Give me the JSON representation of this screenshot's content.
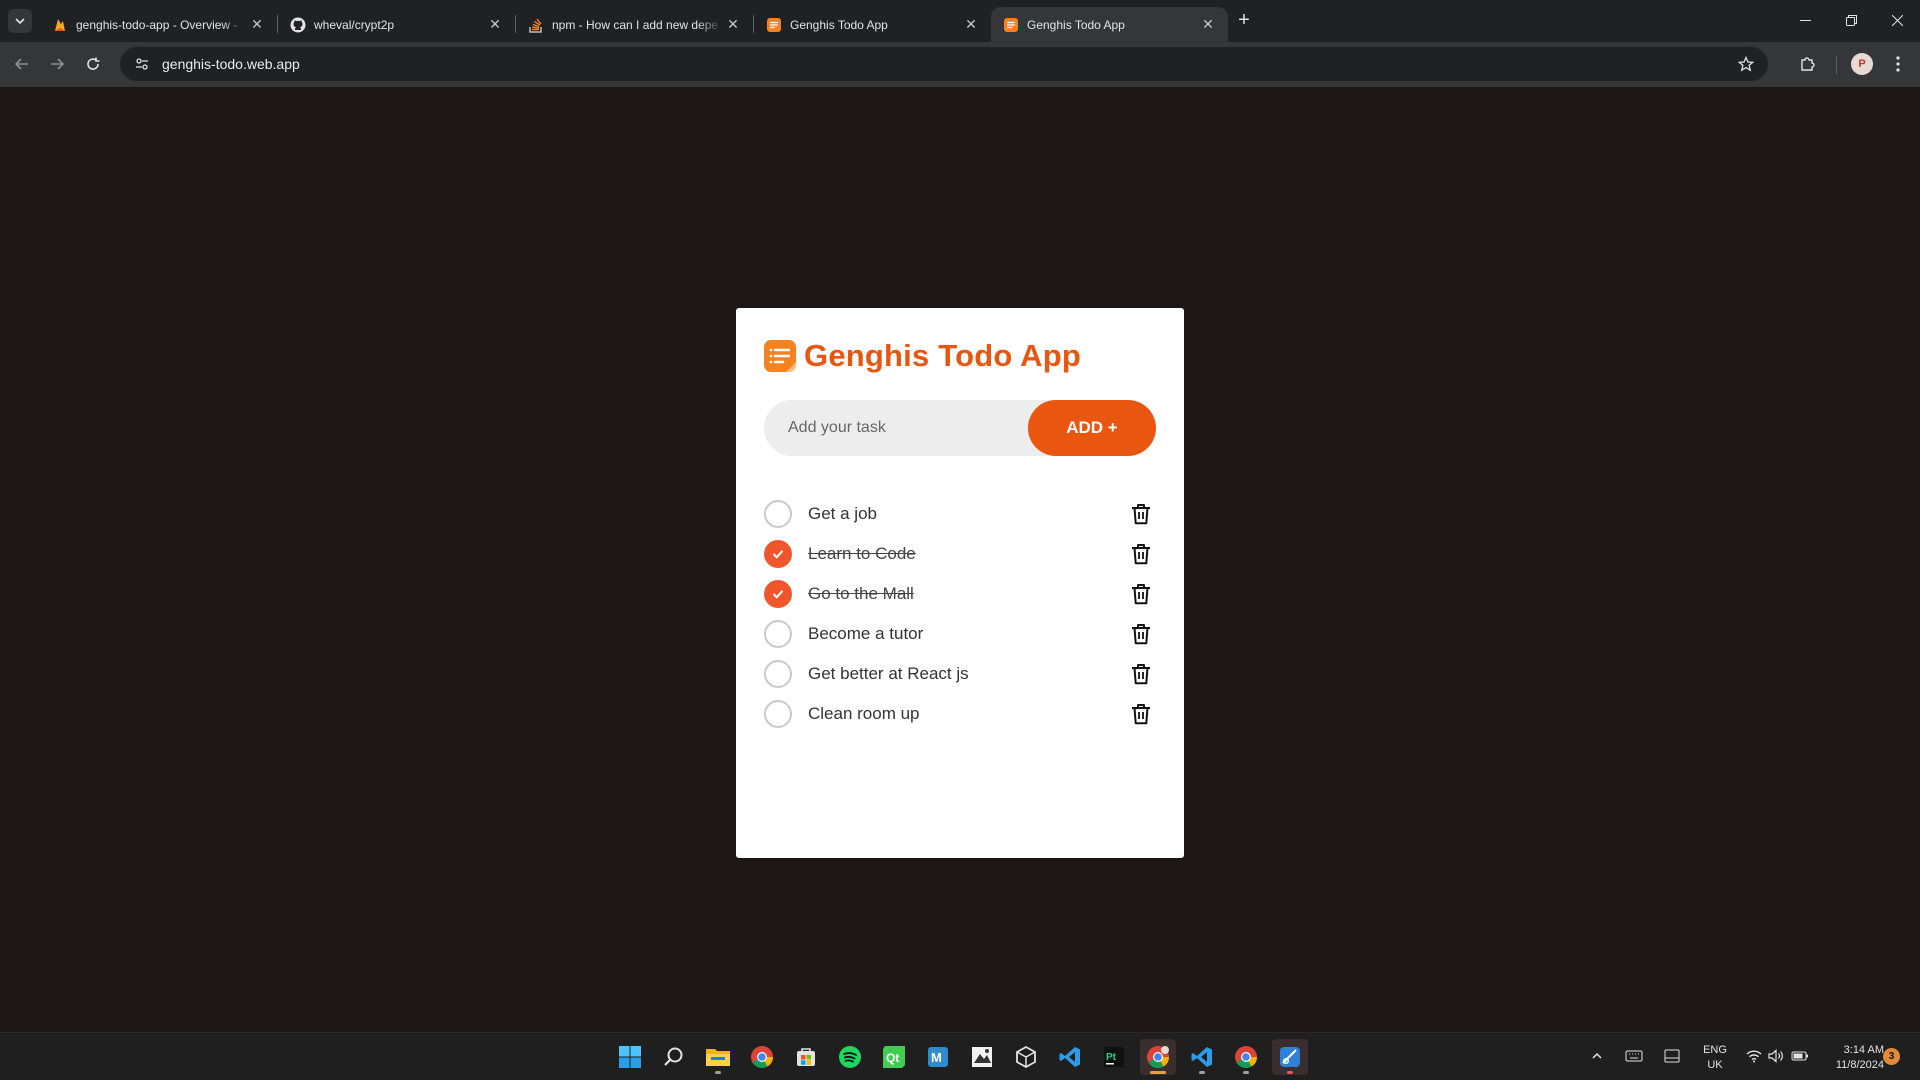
{
  "browser": {
    "tabs": [
      {
        "title": "genghis-todo-app - Overview -",
        "icon": "firebase-icon",
        "active": false
      },
      {
        "title": "wheval/crypt2p",
        "icon": "github-icon",
        "active": false
      },
      {
        "title": "npm - How can I add new depe",
        "icon": "stackoverflow-icon",
        "active": false
      },
      {
        "title": "Genghis Todo App",
        "icon": "todo-app-icon",
        "active": false
      },
      {
        "title": "Genghis Todo App",
        "icon": "todo-app-icon",
        "active": true
      }
    ],
    "url": "genghis-todo.web.app"
  },
  "app": {
    "title": "Genghis Todo App",
    "input_placeholder": "Add your task",
    "input_value": "",
    "add_label": "ADD +",
    "accent_color": "#e8560f",
    "todos": [
      {
        "text": "Get a job",
        "done": false
      },
      {
        "text": "Learn to Code",
        "done": true
      },
      {
        "text": "Go to the Mall",
        "done": true
      },
      {
        "text": "Become a tutor",
        "done": false
      },
      {
        "text": "Get better at React js",
        "done": false
      },
      {
        "text": "Clean room up",
        "done": false
      }
    ]
  },
  "taskbar": {
    "language_line1": "ENG",
    "language_line2": "UK",
    "time": "3:14 AM",
    "date": "11/8/2024",
    "notification_count": "3"
  }
}
